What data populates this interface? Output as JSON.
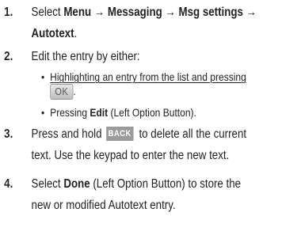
{
  "steps": [
    {
      "number": "1.",
      "line1_pre": "Select ",
      "line1_bold": "Menu → Messaging → Msg settings →",
      "line2_bold": "Autotext",
      "line2_post": "."
    },
    {
      "number": "2.",
      "text": "Edit the entry by either:",
      "bullets": [
        {
          "line1": "Highlighting an entry from the list and pressing",
          "key_label": "OK",
          "line2_post": "."
        },
        {
          "pre": "Pressing ",
          "bold": "Edit",
          "post": " (Left Option Button)."
        }
      ]
    },
    {
      "number": "3.",
      "line1_pre": "Press and hold",
      "key_label": "BACK",
      "line1_post": "to delete all the current",
      "line2": "text. Use the keypad to enter the new text."
    },
    {
      "number": "4.",
      "line1_pre": "Select ",
      "line1_bold": "Done",
      "line1_post": " (Left Option Button) to store the",
      "line2": "new or modified Autotext entry."
    }
  ],
  "bullet_glyph": "•"
}
